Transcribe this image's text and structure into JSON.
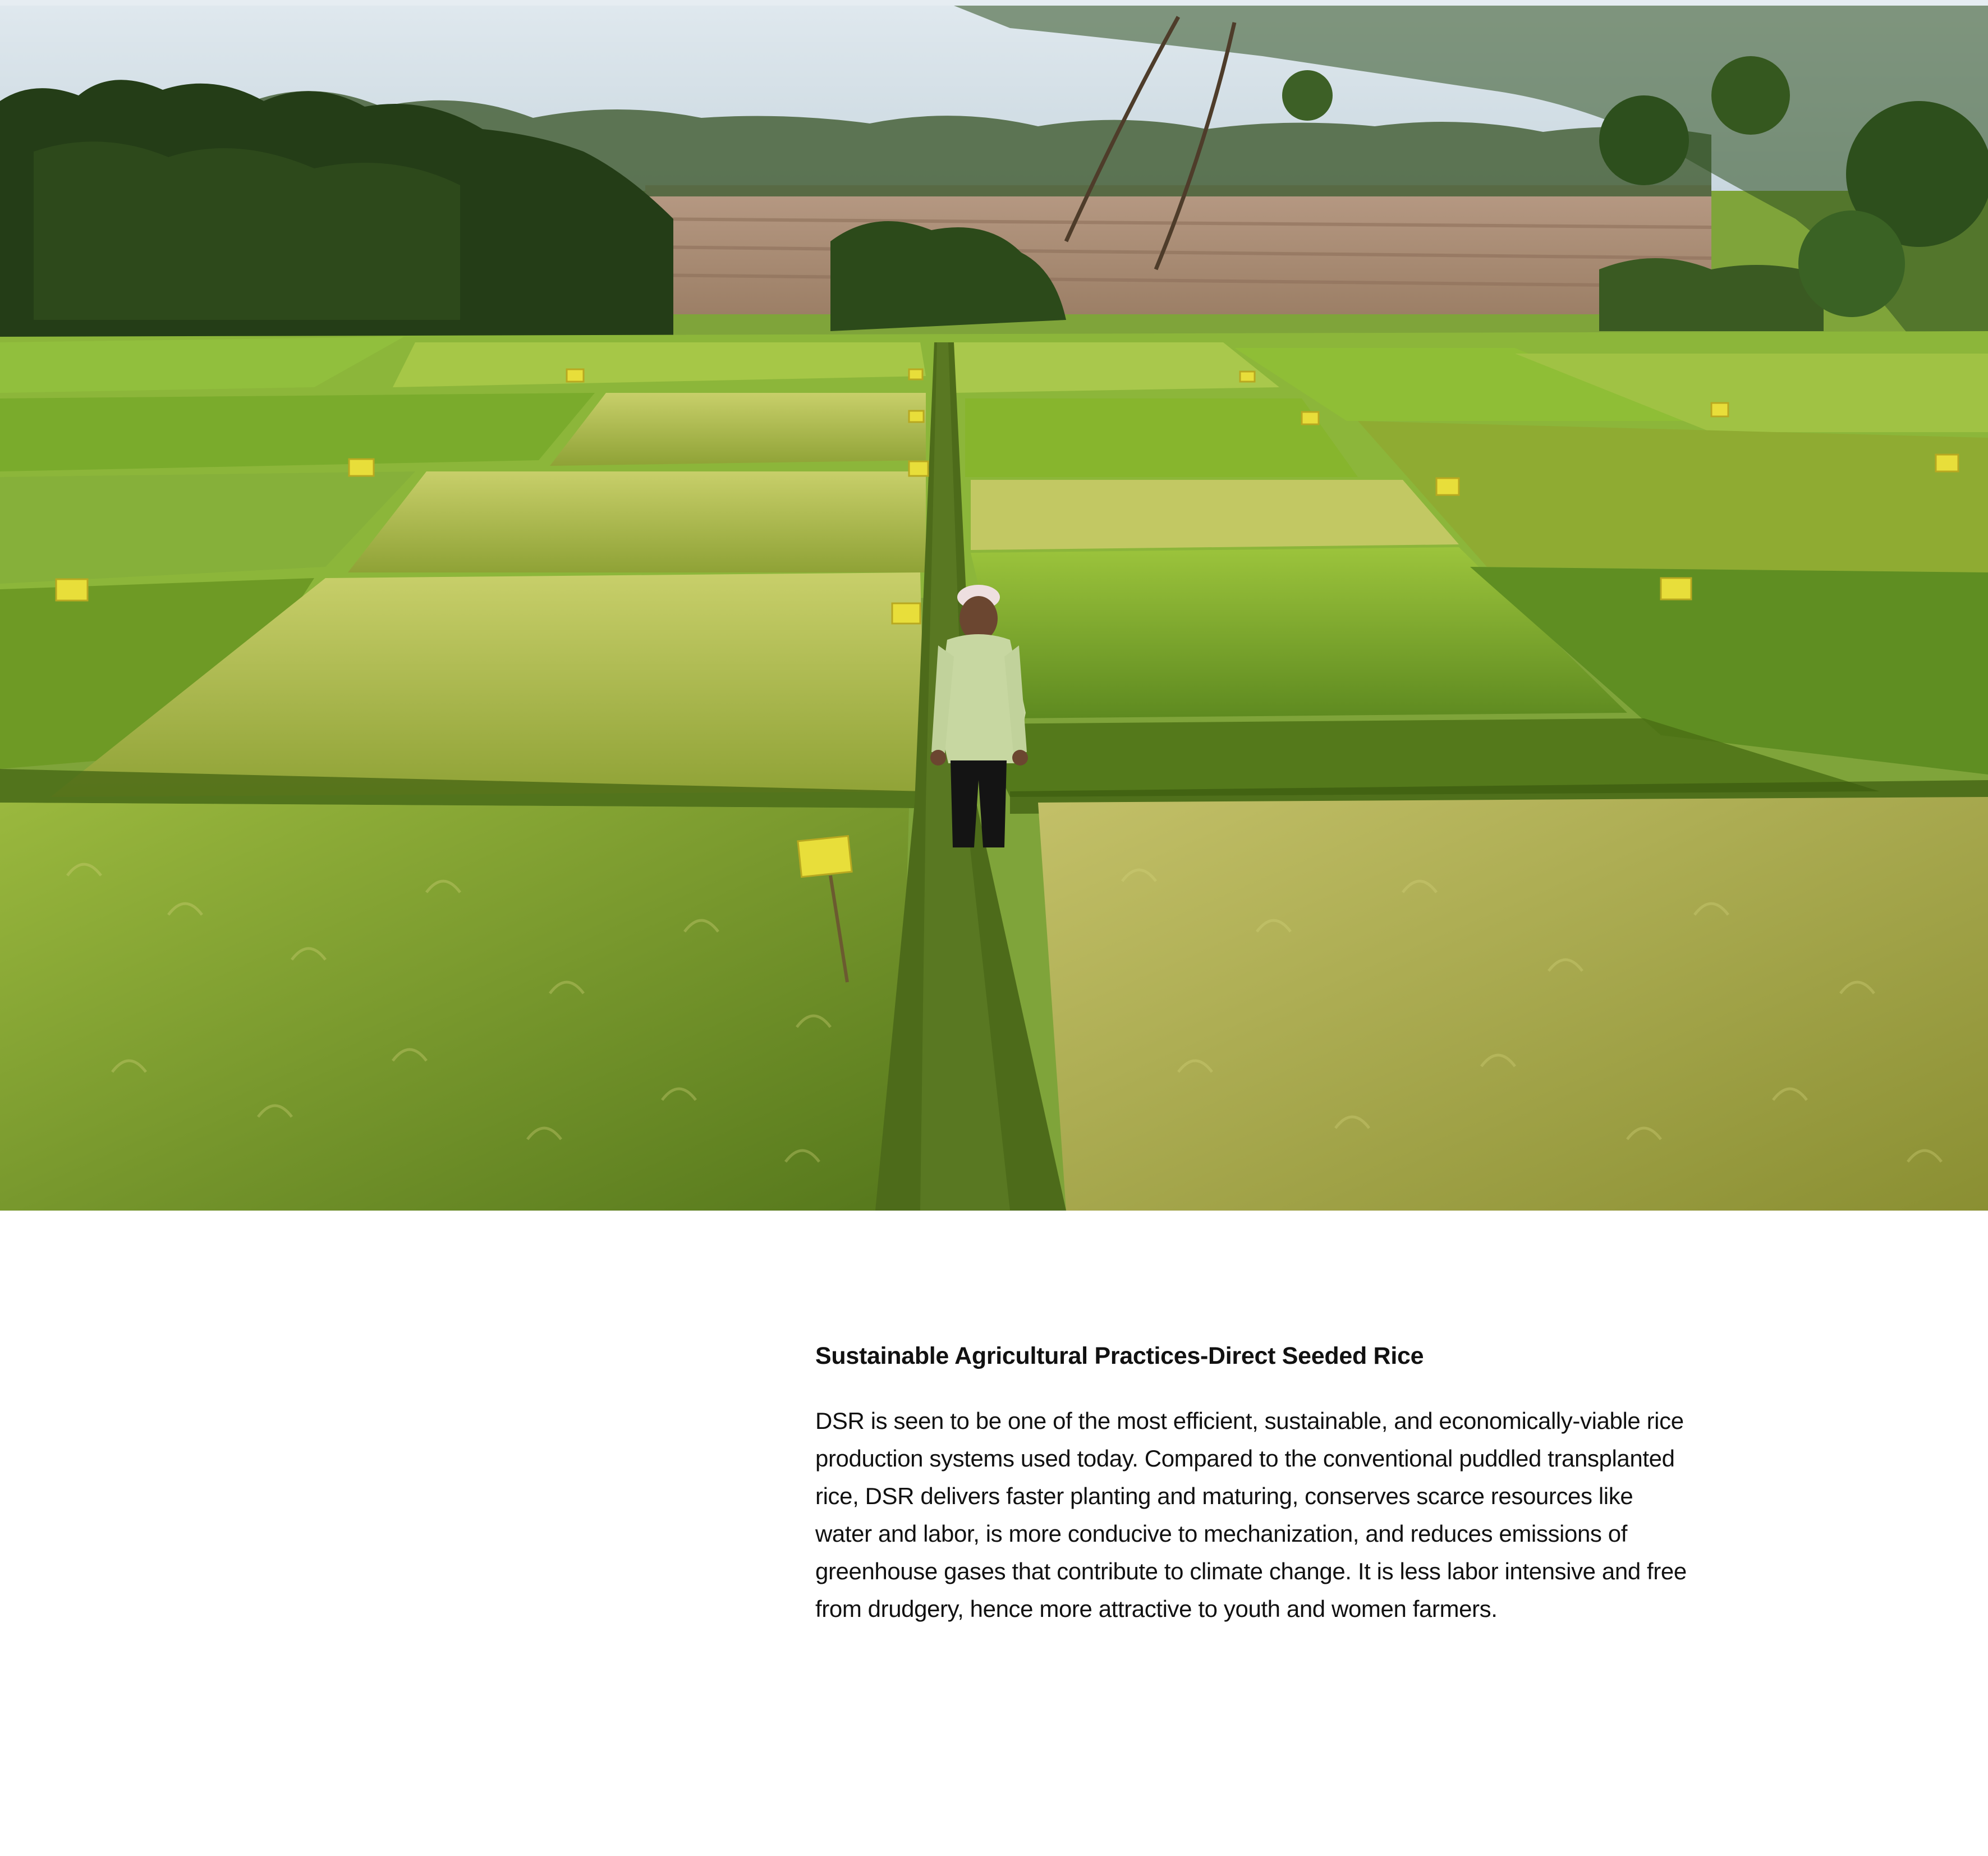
{
  "article": {
    "photo_alt": "Farmer standing on a narrow path between green and yellowing rice plots with yellow markers, trees and fields in background",
    "heading": "Sustainable Agricultural Practices-Direct Seeded Rice",
    "paragraph": "DSR is seen to be one of the most efficient, sustainable, and economically-viable rice\nproduction systems used today. Compared to the conventional puddled transplanted\nrice, DSR delivers faster planting and maturing, conserves scarce resources like\nwater and labor, is more conducive to mechanization, and reduces emissions of\ngreenhouse gases that contribute to climate change. It is less labor intensive and free\nfrom drudgery, hence more attractive to youth and women farmers."
  },
  "colors": {
    "text": "#111111",
    "background": "#ffffff"
  }
}
